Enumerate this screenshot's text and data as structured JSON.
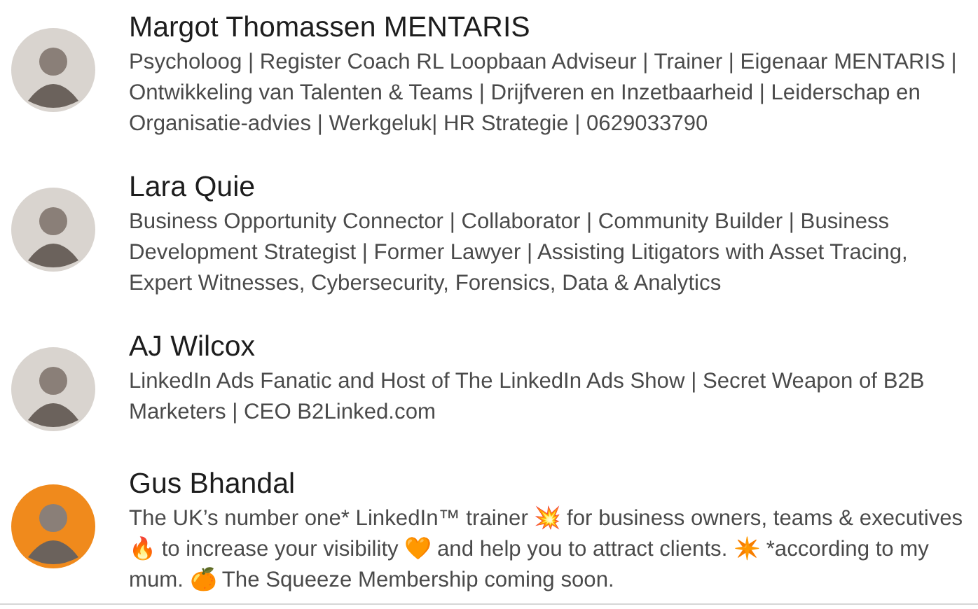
{
  "people": [
    {
      "name": "Margot Thomassen MENTARIS",
      "headline": "Psycholoog | Register Coach RL Loopbaan Adviseur | Trainer | Eigenaar MENTARIS | Ontwikkeling van Talenten & Teams | Drijfveren en Inzetbaarheid | Leiderschap en Organisatie-advies | Werkgeluk| HR Strategie | 0629033790"
    },
    {
      "name": "Lara Quie",
      "headline": "Business Opportunity Connector | Collaborator | Community Builder | Business Development Strategist | Former Lawyer | Assisting Litigators with Asset Tracing, Expert Witnesses, Cybersecurity, Forensics, Data & Analytics"
    },
    {
      "name": "AJ Wilcox",
      "headline": "LinkedIn Ads Fanatic and Host of The LinkedIn Ads Show | Secret Weapon of B2B Marketers | CEO B2Linked.com"
    },
    {
      "name": "Gus Bhandal",
      "headline": "The UK’s number one* LinkedIn™ trainer 💥 for business owners, teams & executives 🔥 to increase your visibility 🧡 and help you to attract clients. ✴️ *according to my mum. 🍊 The Squeeze Membership coming soon."
    }
  ]
}
